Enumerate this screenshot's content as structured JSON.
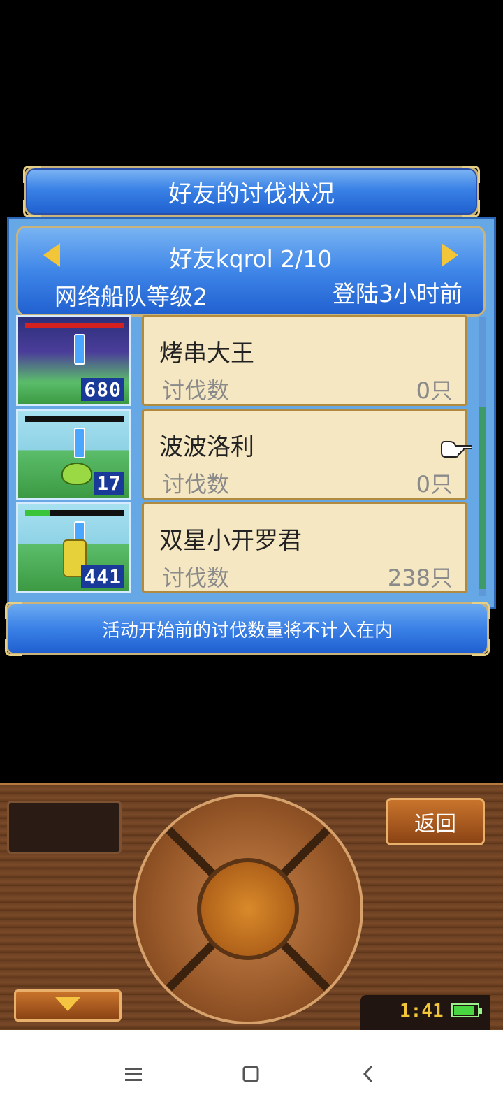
{
  "title": "好友的讨伐状况",
  "friend_header": {
    "name_page": "好友kqrol 2/10",
    "fleet_level": "网络船队等级2",
    "last_login": "登陆3小时前"
  },
  "rows": [
    {
      "name": "烤串大王",
      "kill_label": "讨伐数",
      "kill_count": "0只",
      "thumb_number": "680",
      "hp_fraction": 1.0,
      "hp_color": "#d52020"
    },
    {
      "name": "波波洛利",
      "kill_label": "讨伐数",
      "kill_count": "0只",
      "thumb_number": "17",
      "hp_fraction": 0.0,
      "hp_color": "#d52020"
    },
    {
      "name": "双星小开罗君",
      "kill_label": "讨伐数",
      "kill_count": "238只",
      "thumb_number": "441",
      "hp_fraction": 0.25,
      "hp_color": "#3ac43a"
    }
  ],
  "notice": "活动开始前的讨伐数量将不计入在内",
  "controller": {
    "back_label": "返回",
    "clock": "1:41",
    "battery_level": 0.9
  },
  "colors": {
    "accent_blue": "#3a80e6",
    "card_bg": "#f5e7c2",
    "gold": "#f3c63a"
  },
  "icons": [
    "left-arrow-icon",
    "right-arrow-icon",
    "pointing-hand-icon",
    "down-arrow-icon",
    "battery-icon",
    "menu-icon",
    "home-icon",
    "back-icon"
  ]
}
